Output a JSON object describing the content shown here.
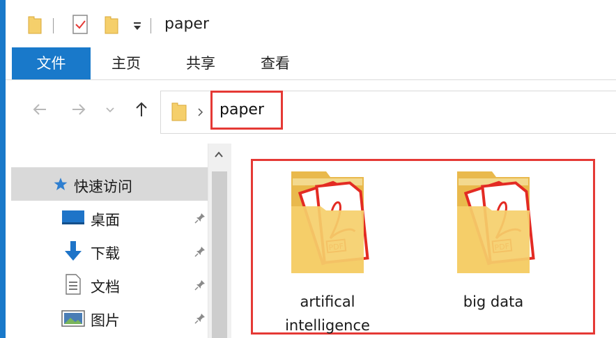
{
  "window": {
    "title": "paper"
  },
  "ribbon": {
    "tabs": [
      {
        "label": "文件"
      },
      {
        "label": "主页"
      },
      {
        "label": "共享"
      },
      {
        "label": "查看"
      }
    ]
  },
  "address": {
    "path": [
      "paper"
    ]
  },
  "navpane": {
    "items": [
      {
        "label": "快速访问",
        "icon": "star-icon"
      },
      {
        "label": "桌面",
        "icon": "desktop-icon",
        "pinned": true
      },
      {
        "label": "下载",
        "icon": "download-icon",
        "pinned": true
      },
      {
        "label": "文档",
        "icon": "document-icon",
        "pinned": true
      },
      {
        "label": "图片",
        "icon": "pictures-icon",
        "pinned": true
      }
    ]
  },
  "content": {
    "folders": [
      {
        "name": "artifical intelligence",
        "icon": "pdf-folder-icon"
      },
      {
        "name": "big data",
        "icon": "pdf-folder-icon"
      }
    ]
  },
  "colors": {
    "accent": "#1979ca",
    "highlight": "#e53935",
    "folder": "#f5cf6b",
    "pdf_red": "#e32b23"
  }
}
